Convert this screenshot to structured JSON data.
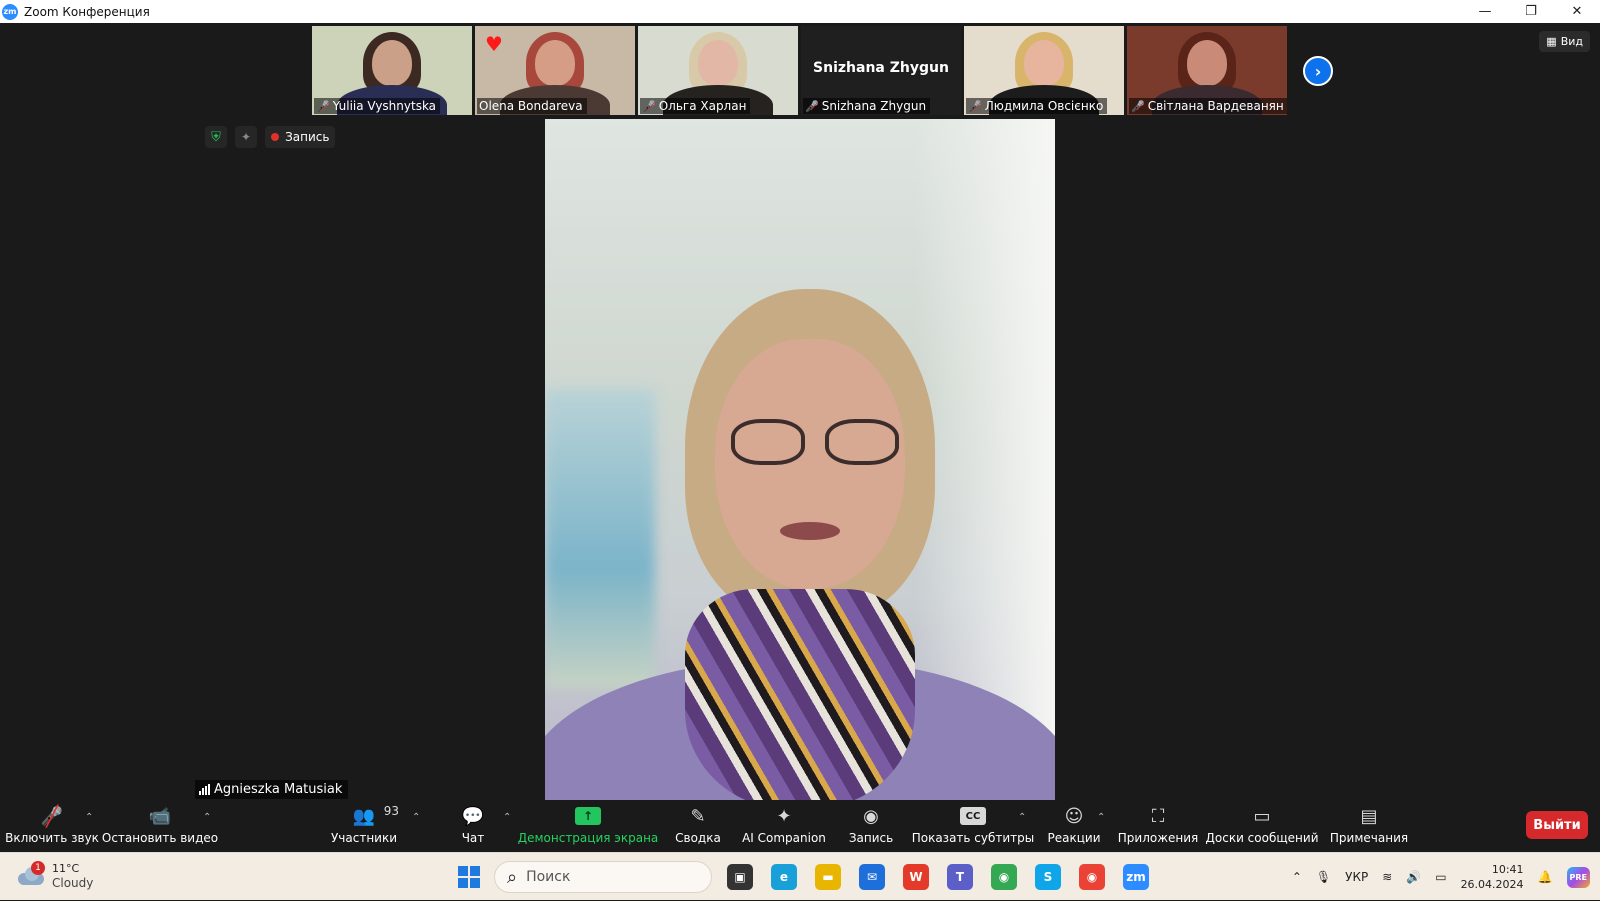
{
  "window": {
    "app_logo": "zm",
    "title": "Zoom Конференция",
    "controls": {
      "minimize": "—",
      "restore": "❐",
      "close": "✕"
    }
  },
  "participants_strip": [
    {
      "name": "Yuliia Vyshnytska",
      "muted": true,
      "video": true,
      "bg": "#cdd3b8",
      "hair": "#3c2a22",
      "skin": "#caa088",
      "body": "#2a2e55"
    },
    {
      "name": "Olena Bondareva",
      "muted": false,
      "video": true,
      "reaction": "♥",
      "bg": "#c8b8a6",
      "hair": "#a8483c",
      "skin": "#d59c86",
      "body": "#4b3a34"
    },
    {
      "name": "Ольга Харлан",
      "muted": true,
      "video": true,
      "bg": "#d8dbd0",
      "hair": "#d8c9a8",
      "skin": "#e2b7a5",
      "body": "#25221f"
    },
    {
      "name": "Snizhana Zhygun",
      "muted": true,
      "video": false
    },
    {
      "name": "Людмила Овсієнко",
      "muted": true,
      "video": true,
      "bg": "#e4dccd",
      "hair": "#d9b56b",
      "skin": "#e7b59e",
      "body": "#1c1c1c"
    },
    {
      "name": "Світлана Вардеванян",
      "muted": true,
      "video": true,
      "bg": "#7a3b2c",
      "hair": "#5a2418",
      "skin": "#c98a78",
      "body": "#3b2a30"
    }
  ],
  "next_page_icon": "›",
  "view_button": {
    "label": "Вид",
    "icon": "▦"
  },
  "meeting_status": {
    "encryption_icon": "shield-check",
    "ai_icon": "sparkle",
    "recording_label": "Запись"
  },
  "active_speaker": {
    "name": "Agnieszka Matusiak"
  },
  "toolbar": {
    "unmute": {
      "label": "Включить звук",
      "icon": "🎤"
    },
    "stop_video": {
      "label": "Остановить видео",
      "icon": "📹"
    },
    "participants": {
      "label": "Участники",
      "count": "93",
      "icon": "👥"
    },
    "chat": {
      "label": "Чат",
      "icon": "💬"
    },
    "share_screen": {
      "label": "Демонстрация экрана",
      "icon": "↑"
    },
    "summary": {
      "label": "Сводка",
      "icon": "✎"
    },
    "ai_companion": {
      "label": "AI Companion",
      "icon": "✦"
    },
    "record": {
      "label": "Запись",
      "icon": "◉"
    },
    "captions": {
      "label": "Показать субтитры",
      "icon": "CC"
    },
    "reactions": {
      "label": "Реакции",
      "icon": "☺"
    },
    "apps": {
      "label": "Приложения",
      "icon": "⛶"
    },
    "whiteboards": {
      "label": "Доски сообщений",
      "icon": "▭"
    },
    "notes": {
      "label": "Примечания",
      "icon": "▤"
    },
    "leave": {
      "label": "Выйти"
    },
    "caret": "⌃"
  },
  "taskbar": {
    "weather": {
      "badge": "1",
      "temp": "11°C",
      "condition": "Cloudy"
    },
    "search_placeholder": "Поиск",
    "search_icon": "⌕",
    "apps": [
      {
        "name": "task-view",
        "glyph": "▣",
        "color": "#333333"
      },
      {
        "name": "edge",
        "glyph": "e",
        "color": "#1aa0d8"
      },
      {
        "name": "explorer",
        "glyph": "▬",
        "color": "#e8b600"
      },
      {
        "name": "mail",
        "glyph": "✉",
        "color": "#1e6fd9"
      },
      {
        "name": "wps",
        "glyph": "W",
        "color": "#e33a2a"
      },
      {
        "name": "teams",
        "glyph": "T",
        "color": "#5b5fc7"
      },
      {
        "name": "chrome-alt",
        "glyph": "◉",
        "color": "#34a853"
      },
      {
        "name": "skype",
        "glyph": "S",
        "color": "#0ea5e9"
      },
      {
        "name": "chrome",
        "glyph": "◉",
        "color": "#ea4335"
      },
      {
        "name": "zoom",
        "glyph": "zm",
        "color": "#2d8cff"
      }
    ],
    "tray": {
      "chevron": "⌃",
      "mic": "🎙",
      "lang": "УКР",
      "wifi": "≋",
      "volume": "🔊",
      "battery": "▭"
    },
    "time": "10:41",
    "date": "26.04.2024",
    "notifications_icon": "🔔",
    "copilot": "PRE"
  }
}
